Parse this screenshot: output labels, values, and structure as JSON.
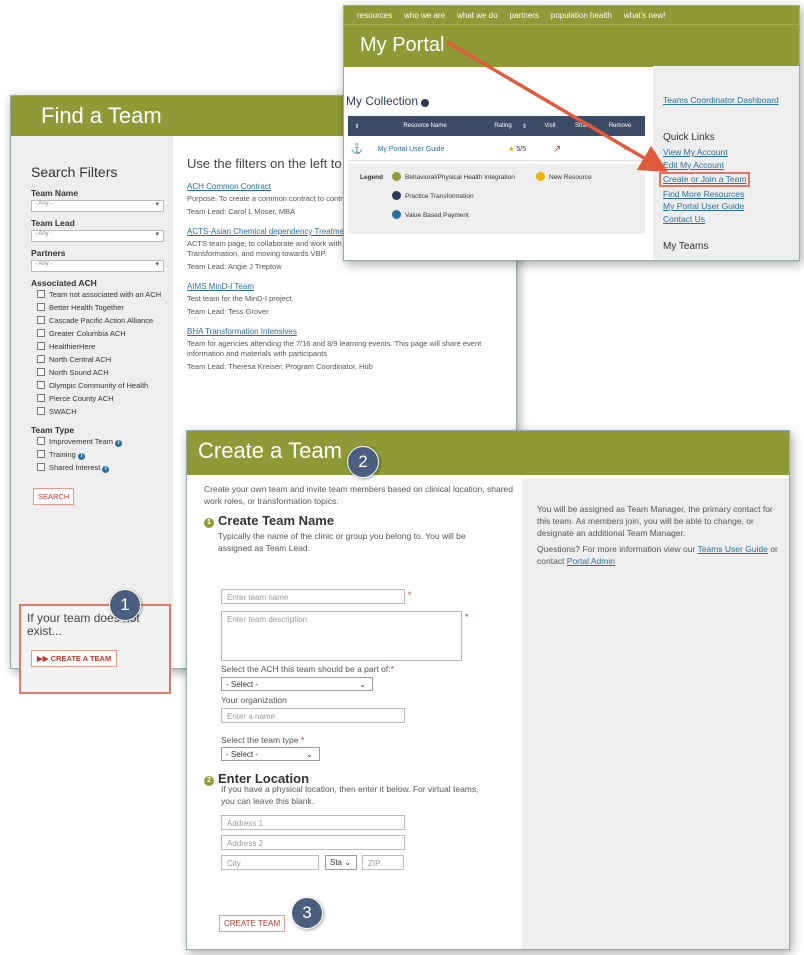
{
  "find_team": {
    "title": "Find a Team",
    "filters_heading": "Search Filters",
    "team_name_label": "Team Name",
    "team_name_value": "- Any -",
    "team_lead_label": "Team Lead",
    "team_lead_value": "- Any -",
    "partners_label": "Partners",
    "partners_value": "- Any -",
    "associated_label": "Associated ACH",
    "ach_options": [
      "Team not associated with an ACH",
      "Better Health Together",
      "Cascade Pacific Action Alliance",
      "Greater Columbia ACH",
      "HealthierHere",
      "North Central ACH",
      "North Sound ACH",
      "Olympic Community of Health",
      "Pierce County ACH",
      "SWACH"
    ],
    "team_type_label": "Team Type",
    "team_types": [
      "Improvement Team",
      "Training",
      "Shared Interest"
    ],
    "search_button": "SEARCH",
    "not_exist_text": "If your team does not exist...",
    "create_button": "CREATE A TEAM",
    "intro": "Use the filters on the left to already exists.",
    "results": [
      {
        "title": "ACH Common Contract",
        "desc": "Purpose: To create a common contract to contracts.",
        "lead": "Team Lead: Carol L Moser, MBA"
      },
      {
        "title": "ACTS-Asian Chemical dependency Treatment Services",
        "desc": "ACTS team page, to collaborate and work with Pierce County ACH during the Medicaid Transformation, and moving towards VBP.",
        "lead": "Team Lead: Angie J Treptow"
      },
      {
        "title": "AIMS MinD-I Team",
        "desc": "Test team for the MinD-I project.",
        "lead": "Team Lead: Tess Grover"
      },
      {
        "title": "BHA Transformation Intensives",
        "desc": "Team for agencies attending the 7/16 and 8/9 learning events. This page will share event information and materials with participants",
        "lead": "Team Lead: Theresa Kreiser, Program Coordinator, Hub"
      }
    ]
  },
  "portal": {
    "nav": [
      "resources",
      "who we are",
      "what we do",
      "partners",
      "population health",
      "what's new!"
    ],
    "title": "My Portal",
    "collection_title": "My Collection",
    "table_headers": [
      "Resource Name",
      "Rating",
      "Visit",
      "Share",
      "Remove"
    ],
    "row": {
      "name": "My Portal User Guide",
      "rating": "5/5"
    },
    "legend_label": "Legend",
    "legend_items": [
      "Behavioral/Physical Health Integration",
      "New Resource",
      "Practice Transformation",
      "Value Based Payment"
    ],
    "dashboard_link": "Teams Coordinator Dashboard",
    "quick_links_title": "Quick Links",
    "quick_links": [
      "View My Account",
      "Edit My Account",
      "Create or Join a Team",
      "Find More Resources",
      "My Portal User Guide",
      "Contact Us"
    ],
    "my_teams": "My Teams"
  },
  "create_team": {
    "title": "Create a Team",
    "intro": "Create your own team and invite team members based on clinical location, shared work roles, or transformation topics.",
    "section1_title": "Create Team Name",
    "section1_help": "Typically the name of the clinic or group you belong to. You will be assigned as Team Lead.",
    "name_placeholder": "Enter team name",
    "desc_placeholder": "Enter team description",
    "ach_label": "Select the ACH this team should be a part of:",
    "ach_value": "- Select -",
    "org_label": "Your organization",
    "org_placeholder": "Enter a name",
    "type_label": "Select the team type",
    "type_value": "- Select -",
    "section2_title": "Enter Location",
    "section2_help": "If you have a physical location, then enter it below. For virtual teams, you can leave this blank.",
    "address1": "Address 1",
    "address2": "Address 2",
    "city": "City",
    "state": "Sta",
    "zip": "ZIP",
    "submit": "CREATE TEAM",
    "side_text1": "You will be assigned as Team Manager, the primary contact for this team. As members join, you will be able to change, or designate an additional Team Manager.",
    "side_text2_a": "Questions? For more information view our",
    "side_link1": "Teams User Guide",
    "side_text2_b": "or contact",
    "side_link2": "Portal Admin"
  },
  "badges": [
    "1",
    "2",
    "3"
  ]
}
